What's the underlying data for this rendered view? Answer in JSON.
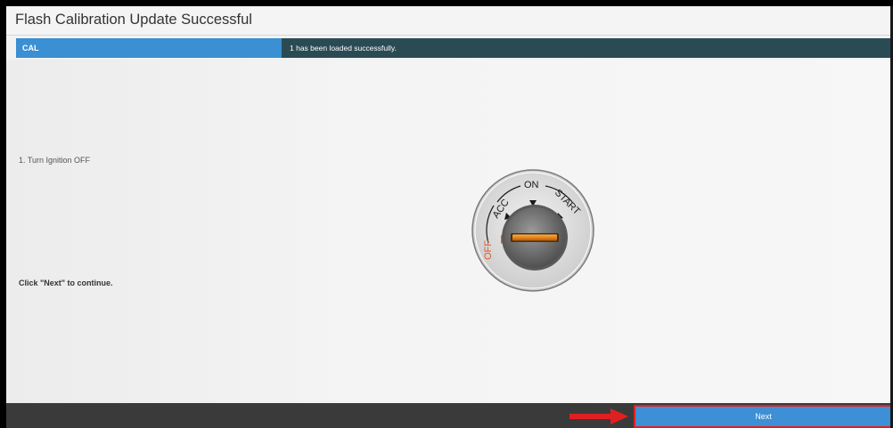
{
  "window": {
    "title": "Flash Calibration Update Successful"
  },
  "status": {
    "label": "CAL",
    "message": "1 has been loaded successfully."
  },
  "instructions": {
    "step1": "1. Turn Ignition OFF",
    "continue": "Click \"Next\" to continue."
  },
  "ignition_switch": {
    "positions": [
      "OFF",
      "ACC",
      "ON",
      "START"
    ],
    "selected": "OFF",
    "icon": "ignition-switch-icon"
  },
  "footer": {
    "next_label": "Next",
    "arrow_icon": "red-arrow-icon"
  },
  "colors": {
    "status_label_bg": "#3b8fd3",
    "status_message_bg": "#2b4b54",
    "next_button_bg": "#3d8fd6",
    "highlight_border": "#e02020",
    "off_color": "#e05a2a"
  }
}
